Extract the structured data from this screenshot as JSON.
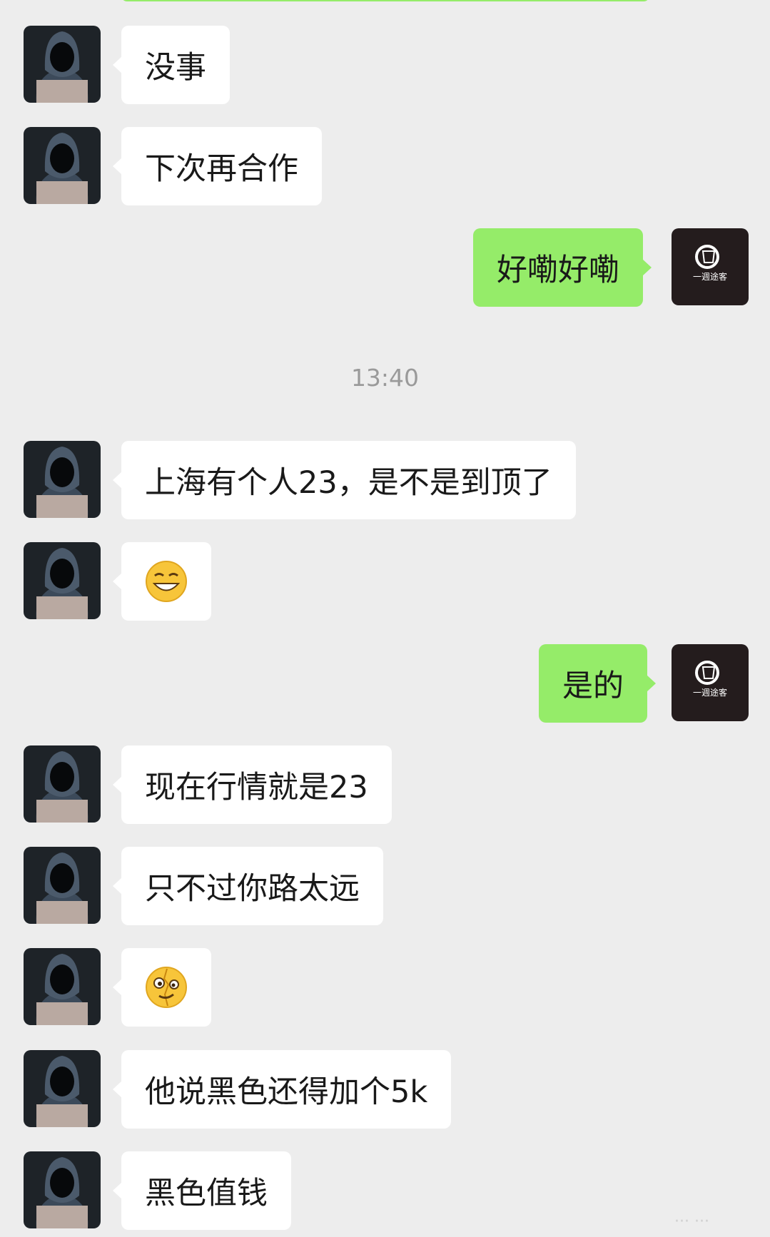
{
  "timestamp": "13:40",
  "messages": [
    {
      "side": "in",
      "text": "没事"
    },
    {
      "side": "in",
      "text": "下次再合作"
    },
    {
      "side": "out",
      "text": "好嘞好嘞"
    },
    {
      "side": "in",
      "text": "上海有个人23，是不是到顶了"
    },
    {
      "side": "in",
      "emoji": "grinning-squint-face"
    },
    {
      "side": "out",
      "text": "是的"
    },
    {
      "side": "in",
      "text": "现在行情就是23"
    },
    {
      "side": "in",
      "text": "只不过你路太远"
    },
    {
      "side": "in",
      "emoji": "zany-cracked-face"
    },
    {
      "side": "in",
      "text": "他说黑色还得加个5k"
    },
    {
      "side": "in",
      "text": "黑色值钱"
    }
  ],
  "brand_logo_text": "一週途客",
  "watermark": "··· ···",
  "colors": {
    "background": "#ededed",
    "outgoing": "#95ec69",
    "incoming": "#ffffff"
  }
}
